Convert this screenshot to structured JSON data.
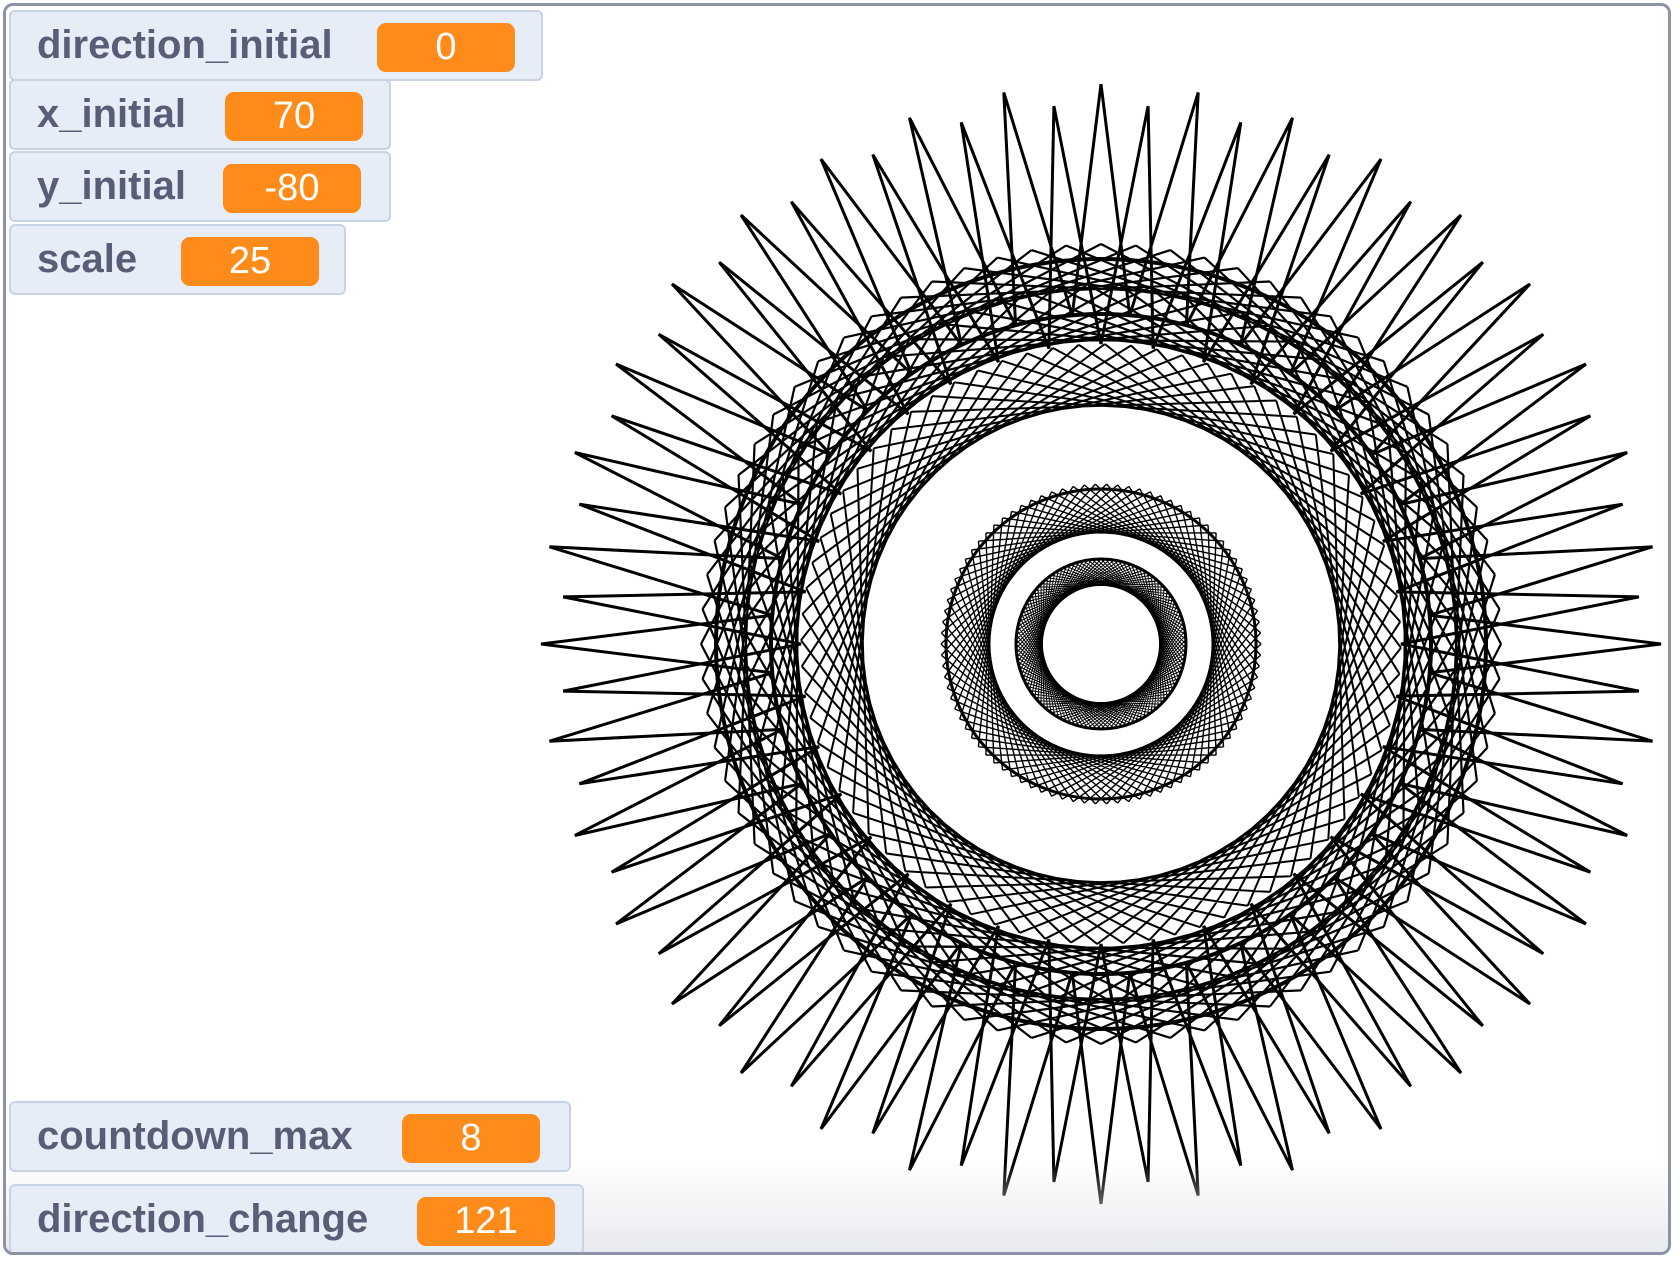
{
  "monitors": {
    "direction_initial": {
      "label": "direction_initial",
      "value": "0"
    },
    "x_initial": {
      "label": "x_initial",
      "value": "70"
    },
    "y_initial": {
      "label": "y_initial",
      "value": "-80"
    },
    "scale": {
      "label": "scale",
      "value": "25"
    },
    "countdown_max": {
      "label": "countdown_max",
      "value": "8"
    },
    "direction_change": {
      "label": "direction_change",
      "value": "121"
    }
  },
  "colors": {
    "monitor_background": "#e7edf7",
    "monitor_border": "#c8d3e6",
    "value_badge": "#ff8c1a",
    "label_text": "#575e75",
    "pen": "#000000"
  },
  "drawing": {
    "kind": "spirograph-pattern"
  }
}
